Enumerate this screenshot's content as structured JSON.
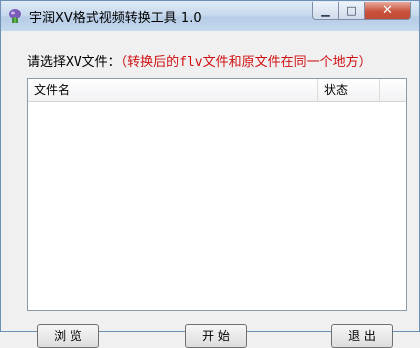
{
  "window": {
    "title": "宇润XV格式视频转换工具 1.0",
    "controls": {
      "minimize": "▁",
      "maximize": "□",
      "close": "✕"
    }
  },
  "main": {
    "prompt_label": "请选择XV文件：",
    "prompt_note": "（转换后的flv文件和原文件在同一个地方）"
  },
  "file_list": {
    "columns": [
      "文件名",
      "状态",
      ""
    ],
    "rows": []
  },
  "buttons": {
    "browse": "浏 览",
    "start": "开 始",
    "exit": "退 出"
  },
  "colors": {
    "note": "#d01010",
    "window_bg": "#f0f0f0"
  }
}
